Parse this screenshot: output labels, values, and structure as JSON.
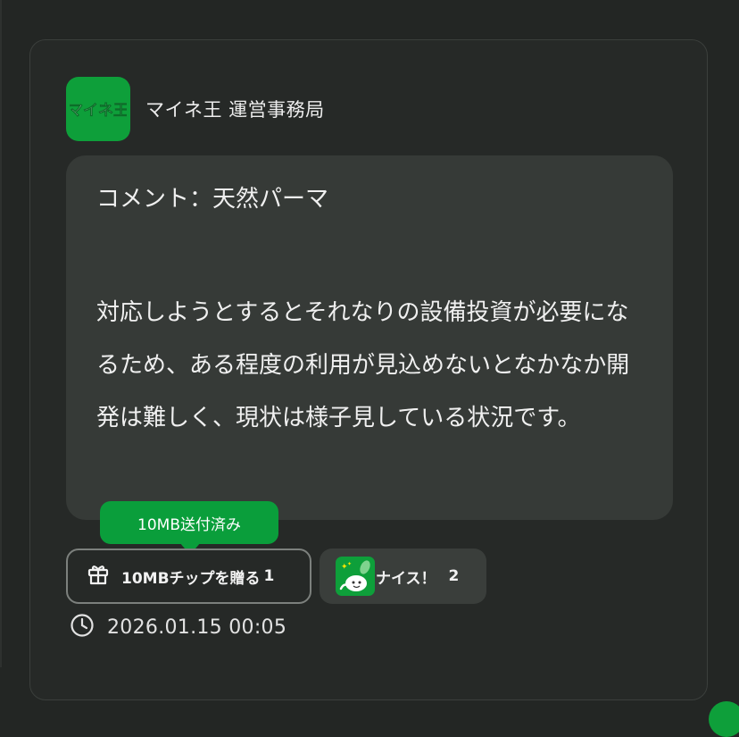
{
  "colors": {
    "background": "#232624",
    "card": "#262927",
    "bubble": "#363a37",
    "accent_green": "#0a9e3b",
    "text": "#f0f0f0"
  },
  "post": {
    "publisher_name": "マイネ王 運営事務局",
    "app_icon_text": "マイネ王",
    "app_icon": "mineo-app-icon",
    "comment_line": "コメント：天然パーマ",
    "body": "対応しようとするとそれなりの設備投資が必要になるため、ある程度の利用が見込めないとなかなか開発は難しく、現状は様子見している状況です。"
  },
  "actions": {
    "tooltip": "10MB送付済み",
    "tip_button_icon": "gift-icon",
    "tip_button_label": "10MBチップを贈る",
    "tip_button_count": "1",
    "nice_icon": "nice-stamp-icon",
    "nice_label": "ナイス！",
    "nice_count": "2"
  },
  "meta": {
    "clock_icon": "clock-icon",
    "timestamp": "2026.01.15 00:05"
  }
}
